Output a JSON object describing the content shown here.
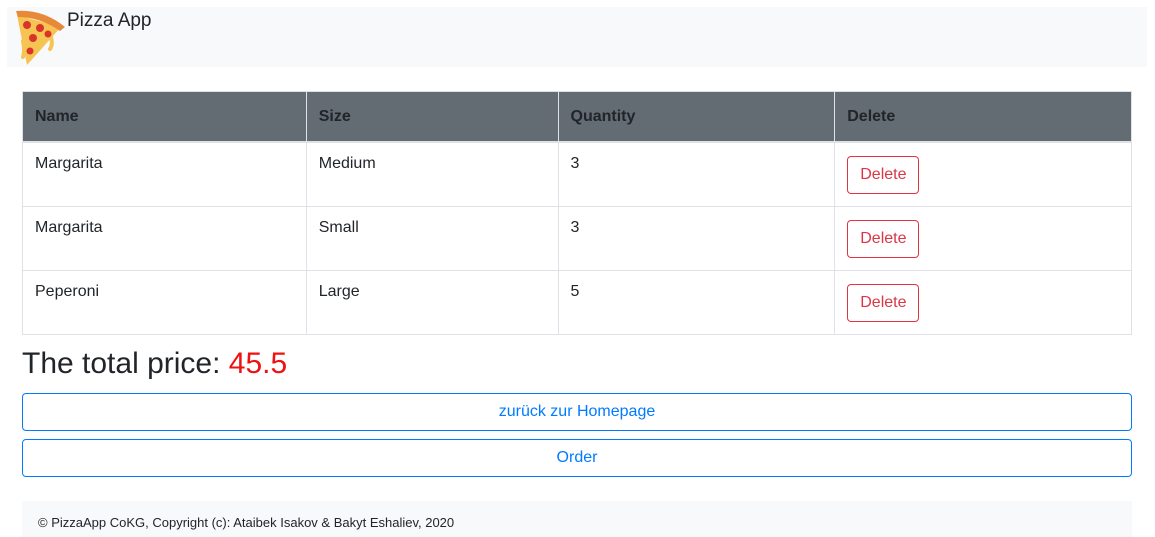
{
  "navbar": {
    "brand": "Pizza App",
    "logo_icon": "pizza-slice-icon"
  },
  "table": {
    "headers": [
      "Name",
      "Size",
      "Quantity",
      "Delete"
    ],
    "rows": [
      {
        "name": "Margarita",
        "size": "Medium",
        "quantity": "3",
        "action": "Delete"
      },
      {
        "name": "Margarita",
        "size": "Small",
        "quantity": "3",
        "action": "Delete"
      },
      {
        "name": "Peperoni",
        "size": "Large",
        "quantity": "5",
        "action": "Delete"
      }
    ]
  },
  "total": {
    "label": "The total price:",
    "value": "45.5",
    "value_color": "#ee1111"
  },
  "buttons": {
    "home": "zurück zur Homepage",
    "order": "Order"
  },
  "footer": {
    "text": "© PizzaApp CoKG, Copyright (c): Ataibek Isakov & Bakyt Eshaliev, 2020"
  },
  "colors": {
    "primary": "#007bff",
    "danger": "#dc3545",
    "table_header_bg": "#636b73",
    "navbar_bg": "#f8f9fa"
  }
}
